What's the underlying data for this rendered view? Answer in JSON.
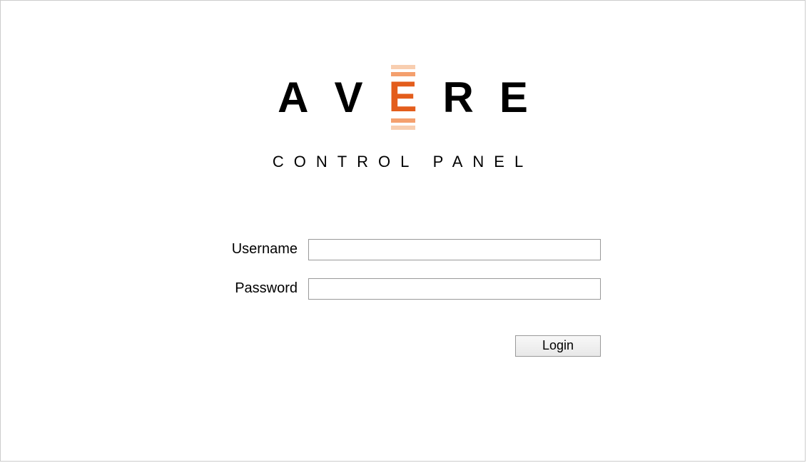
{
  "brand": {
    "letters": [
      "A",
      "V",
      "E",
      "R",
      "E"
    ],
    "subtitle": "CONTROL PANEL"
  },
  "form": {
    "username_label": "Username",
    "password_label": "Password",
    "username_value": "",
    "password_value": "",
    "login_label": "Login"
  }
}
